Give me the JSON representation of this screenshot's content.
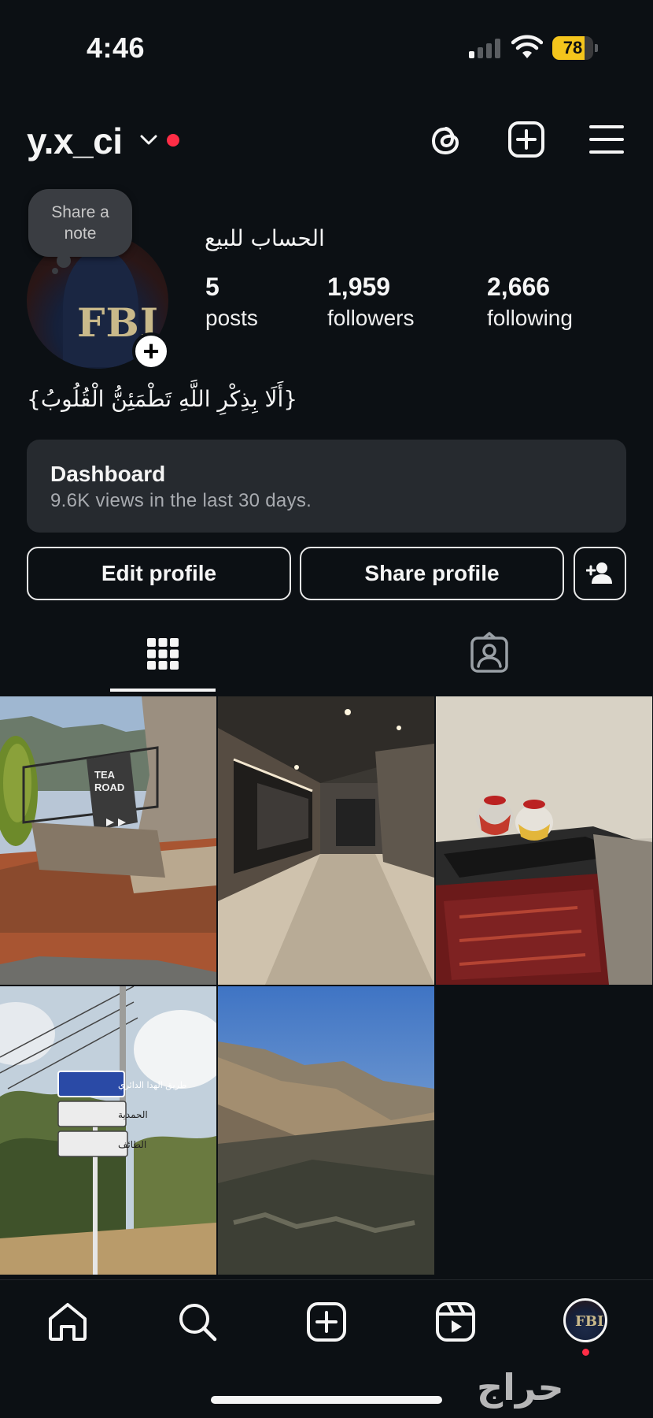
{
  "status_bar": {
    "time": "4:46",
    "battery_level": "78",
    "battery_fraction": 0.78,
    "signal_bars_on": 1,
    "signal_bars_total": 4
  },
  "header": {
    "username": "y.x_ci",
    "icons": [
      "chevron-down-icon",
      "threads-icon",
      "create-post-icon",
      "menu-icon"
    ]
  },
  "profile": {
    "note_prompt_line1": "Share a",
    "note_prompt_line2": "note",
    "avatar_text": "FBI",
    "add_story_symbol": "+",
    "display_name": "الحساب للبيع",
    "stats": [
      {
        "value": "5",
        "label": "posts"
      },
      {
        "value": "1,959",
        "label": "followers"
      },
      {
        "value": "2,666",
        "label": "following"
      }
    ],
    "bio": "{أَلَا بِذِكْرِ اللَّهِ تَطْمَئِنُّ الْقُلُوبُ}"
  },
  "dashboard": {
    "title": "Dashboard",
    "subtitle": "9.6K views in the last 30 days."
  },
  "actions": {
    "edit_profile": "Edit profile",
    "share_profile": "Share profile"
  },
  "tabs": [
    "grid-icon",
    "tagged-icon"
  ],
  "grid": {
    "posts": [
      "post-tea-road",
      "post-mall-corridor",
      "post-teapots",
      "post-road-signs",
      "post-mountains"
    ],
    "sign_text": {
      "tea_road_1": "TEA",
      "tea_road_2": "ROAD",
      "sign_1": "طريق الهدا الدائري",
      "sign_2": "الحمدية",
      "sign_3": "الطائف"
    }
  },
  "bottom_nav": {
    "items": [
      "home-icon",
      "search-icon",
      "create-icon",
      "reels-icon",
      "profile-avatar"
    ],
    "avatar_text": "FBI"
  },
  "watermark": "حراج",
  "colors": {
    "background": "#0c1014",
    "card": "#262a2f",
    "notification_dot": "#ff2d46",
    "battery": "#f4c51c"
  }
}
